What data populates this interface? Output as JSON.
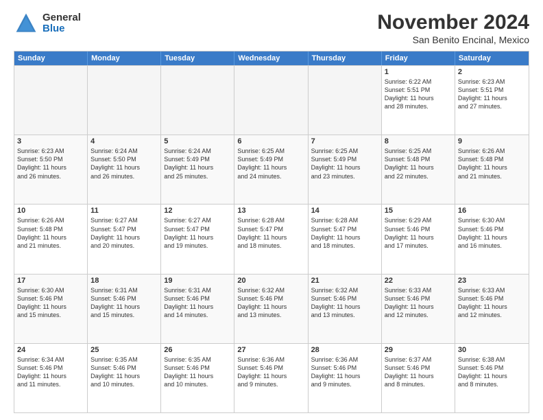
{
  "logo": {
    "general": "General",
    "blue": "Blue"
  },
  "header": {
    "month": "November 2024",
    "location": "San Benito Encinal, Mexico"
  },
  "weekdays": [
    "Sunday",
    "Monday",
    "Tuesday",
    "Wednesday",
    "Thursday",
    "Friday",
    "Saturday"
  ],
  "rows": [
    [
      {
        "day": "",
        "info": "",
        "empty": true
      },
      {
        "day": "",
        "info": "",
        "empty": true
      },
      {
        "day": "",
        "info": "",
        "empty": true
      },
      {
        "day": "",
        "info": "",
        "empty": true
      },
      {
        "day": "",
        "info": "",
        "empty": true
      },
      {
        "day": "1",
        "info": "Sunrise: 6:22 AM\nSunset: 5:51 PM\nDaylight: 11 hours\nand 28 minutes.",
        "empty": false
      },
      {
        "day": "2",
        "info": "Sunrise: 6:23 AM\nSunset: 5:51 PM\nDaylight: 11 hours\nand 27 minutes.",
        "empty": false
      }
    ],
    [
      {
        "day": "3",
        "info": "Sunrise: 6:23 AM\nSunset: 5:50 PM\nDaylight: 11 hours\nand 26 minutes.",
        "empty": false
      },
      {
        "day": "4",
        "info": "Sunrise: 6:24 AM\nSunset: 5:50 PM\nDaylight: 11 hours\nand 26 minutes.",
        "empty": false
      },
      {
        "day": "5",
        "info": "Sunrise: 6:24 AM\nSunset: 5:49 PM\nDaylight: 11 hours\nand 25 minutes.",
        "empty": false
      },
      {
        "day": "6",
        "info": "Sunrise: 6:25 AM\nSunset: 5:49 PM\nDaylight: 11 hours\nand 24 minutes.",
        "empty": false
      },
      {
        "day": "7",
        "info": "Sunrise: 6:25 AM\nSunset: 5:49 PM\nDaylight: 11 hours\nand 23 minutes.",
        "empty": false
      },
      {
        "day": "8",
        "info": "Sunrise: 6:25 AM\nSunset: 5:48 PM\nDaylight: 11 hours\nand 22 minutes.",
        "empty": false
      },
      {
        "day": "9",
        "info": "Sunrise: 6:26 AM\nSunset: 5:48 PM\nDaylight: 11 hours\nand 21 minutes.",
        "empty": false
      }
    ],
    [
      {
        "day": "10",
        "info": "Sunrise: 6:26 AM\nSunset: 5:48 PM\nDaylight: 11 hours\nand 21 minutes.",
        "empty": false
      },
      {
        "day": "11",
        "info": "Sunrise: 6:27 AM\nSunset: 5:47 PM\nDaylight: 11 hours\nand 20 minutes.",
        "empty": false
      },
      {
        "day": "12",
        "info": "Sunrise: 6:27 AM\nSunset: 5:47 PM\nDaylight: 11 hours\nand 19 minutes.",
        "empty": false
      },
      {
        "day": "13",
        "info": "Sunrise: 6:28 AM\nSunset: 5:47 PM\nDaylight: 11 hours\nand 18 minutes.",
        "empty": false
      },
      {
        "day": "14",
        "info": "Sunrise: 6:28 AM\nSunset: 5:47 PM\nDaylight: 11 hours\nand 18 minutes.",
        "empty": false
      },
      {
        "day": "15",
        "info": "Sunrise: 6:29 AM\nSunset: 5:46 PM\nDaylight: 11 hours\nand 17 minutes.",
        "empty": false
      },
      {
        "day": "16",
        "info": "Sunrise: 6:30 AM\nSunset: 5:46 PM\nDaylight: 11 hours\nand 16 minutes.",
        "empty": false
      }
    ],
    [
      {
        "day": "17",
        "info": "Sunrise: 6:30 AM\nSunset: 5:46 PM\nDaylight: 11 hours\nand 15 minutes.",
        "empty": false
      },
      {
        "day": "18",
        "info": "Sunrise: 6:31 AM\nSunset: 5:46 PM\nDaylight: 11 hours\nand 15 minutes.",
        "empty": false
      },
      {
        "day": "19",
        "info": "Sunrise: 6:31 AM\nSunset: 5:46 PM\nDaylight: 11 hours\nand 14 minutes.",
        "empty": false
      },
      {
        "day": "20",
        "info": "Sunrise: 6:32 AM\nSunset: 5:46 PM\nDaylight: 11 hours\nand 13 minutes.",
        "empty": false
      },
      {
        "day": "21",
        "info": "Sunrise: 6:32 AM\nSunset: 5:46 PM\nDaylight: 11 hours\nand 13 minutes.",
        "empty": false
      },
      {
        "day": "22",
        "info": "Sunrise: 6:33 AM\nSunset: 5:46 PM\nDaylight: 11 hours\nand 12 minutes.",
        "empty": false
      },
      {
        "day": "23",
        "info": "Sunrise: 6:33 AM\nSunset: 5:46 PM\nDaylight: 11 hours\nand 12 minutes.",
        "empty": false
      }
    ],
    [
      {
        "day": "24",
        "info": "Sunrise: 6:34 AM\nSunset: 5:46 PM\nDaylight: 11 hours\nand 11 minutes.",
        "empty": false
      },
      {
        "day": "25",
        "info": "Sunrise: 6:35 AM\nSunset: 5:46 PM\nDaylight: 11 hours\nand 10 minutes.",
        "empty": false
      },
      {
        "day": "26",
        "info": "Sunrise: 6:35 AM\nSunset: 5:46 PM\nDaylight: 11 hours\nand 10 minutes.",
        "empty": false
      },
      {
        "day": "27",
        "info": "Sunrise: 6:36 AM\nSunset: 5:46 PM\nDaylight: 11 hours\nand 9 minutes.",
        "empty": false
      },
      {
        "day": "28",
        "info": "Sunrise: 6:36 AM\nSunset: 5:46 PM\nDaylight: 11 hours\nand 9 minutes.",
        "empty": false
      },
      {
        "day": "29",
        "info": "Sunrise: 6:37 AM\nSunset: 5:46 PM\nDaylight: 11 hours\nand 8 minutes.",
        "empty": false
      },
      {
        "day": "30",
        "info": "Sunrise: 6:38 AM\nSunset: 5:46 PM\nDaylight: 11 hours\nand 8 minutes.",
        "empty": false
      }
    ]
  ]
}
